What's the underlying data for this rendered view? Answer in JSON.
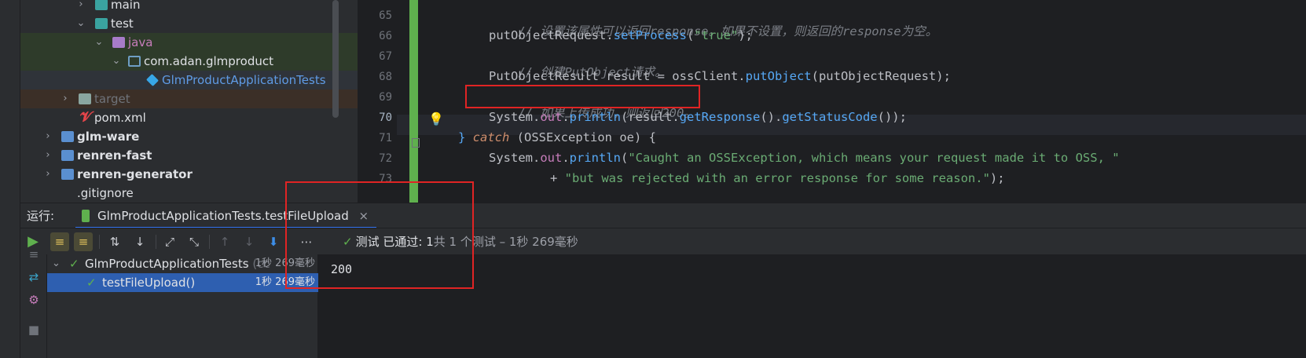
{
  "project_tree": [
    {
      "label": "main"
    },
    {
      "label": "test"
    },
    {
      "label": "java"
    },
    {
      "label": "com.adan.glmproduct"
    },
    {
      "label": "GlmProductApplicationTests"
    },
    {
      "label": "target"
    },
    {
      "label": "pom.xml"
    },
    {
      "label": "glm-ware"
    },
    {
      "label": "renren-fast"
    },
    {
      "label": "renren-generator"
    },
    {
      "label": ".gitignore"
    }
  ],
  "editor": {
    "line_numbers": [
      "65",
      "66",
      "67",
      "68",
      "69",
      "70",
      "71",
      "72",
      "73"
    ],
    "lines": {
      "l65": "// 设置该属性可以返回response。如果不设置，则返回的response为空。",
      "l66_a": "putObjectRequest.",
      "l66_b": "setProcess",
      "l66_c": "(",
      "l66_d": "\"true\"",
      "l66_e": ");",
      "l67": "// 创建PutObject请求。",
      "l68_a": "PutObjectResult result = ossClient.",
      "l68_b": "putObject",
      "l68_c": "(putObjectRequest);",
      "l69": "// 如果上传成功，则返回200。",
      "l70_a": "System.",
      "l70_b": "out",
      "l70_c": ".",
      "l70_d": "println",
      "l70_e": "(result.",
      "l70_f": "getResponse",
      "l70_g": "().",
      "l70_h": "getStatusCode",
      "l70_i": "());",
      "l71_a": "} ",
      "l71_b": "catch",
      "l71_c": " (OSSException oe) {",
      "l72_a": "System.",
      "l72_b": "out",
      "l72_c": ".",
      "l72_d": "println",
      "l72_e": "(",
      "l72_f": "\"Caught an OSSException, which means your request made it to OSS, \"",
      "l73_a": "+ ",
      "l73_b": "\"but was rejected with an error response for some reason.\"",
      "l73_c": ");"
    }
  },
  "run_panel": {
    "label": "运行:",
    "tab_title": "GlmProductApplicationTests.testFileUpload",
    "tab_close": "×",
    "status": {
      "icon": "✓",
      "main": "测试 已通过:",
      "count": "1",
      "detail": "共 1 个测试 – 1秒 269毫秒"
    },
    "toolbar_more": "⋯",
    "tests": [
      {
        "name": "GlmProductApplicationTests",
        "hint": "(cc",
        "duration": "1秒 269毫秒"
      },
      {
        "name": "testFileUpload()",
        "duration": "1秒 269毫秒"
      }
    ],
    "console_output": "200"
  },
  "icons": {
    "chevron_right": "chevron-right-icon",
    "chevron_down": "chevron-down-icon",
    "run": "run-icon",
    "bulb": "lightbulb-icon"
  },
  "colors": {
    "accent": "#3574f0",
    "pass": "#5fb04e",
    "highlight_box": "#e02424"
  }
}
